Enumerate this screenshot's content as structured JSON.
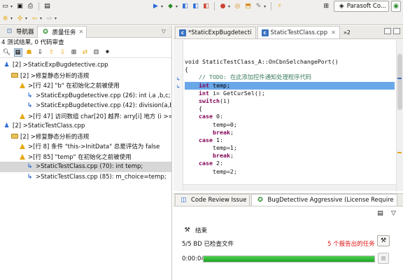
{
  "toolbar": {
    "perspective_label": "Parasoft Co...",
    "colors": {
      "run": "#2a6ad6",
      "stop": "#c43",
      "accent": "#e6a814"
    }
  },
  "left_panel": {
    "tabs": [
      {
        "label": "导航器",
        "active": false
      },
      {
        "label": "质量任务",
        "active": true
      }
    ],
    "close_glyph": "✕",
    "summary": "4 测试结果, 0 代码审查",
    "menu_glyph": "▽",
    "tree": [
      {
        "indent": 0,
        "icon": "user-violation-icon",
        "text": "[2] >StaticExpBugdetective.cpp"
      },
      {
        "indent": 1,
        "icon": "folder-icon",
        "text": "[2] >修复静态分析的违规"
      },
      {
        "indent": 2,
        "icon": "warning-icon",
        "text": ">[行 42] \"b\" 在初始化之前被使用"
      },
      {
        "indent": 3,
        "icon": "flow-step-icon",
        "text": ">StaticExpBugdetective.cpp (26): int i,a ,b,c;"
      },
      {
        "indent": 3,
        "icon": "flow-step-icon",
        "text": ">StaticExpBugdetective.cpp (42): division(a,b);"
      },
      {
        "indent": 2,
        "icon": "warning-icon",
        "text": ">[行 47] 访问数组 char[20] 越界: arry[i] 地方 (i >= 2"
      },
      {
        "indent": 0,
        "icon": "user-violation-icon",
        "text": "[2] >StaticTestClass.cpp"
      },
      {
        "indent": 1,
        "icon": "folder-icon",
        "text": "[2] >修复静态分析的违规"
      },
      {
        "indent": 2,
        "icon": "warning-icon",
        "text": ">[行 8] 条件 \"this->InitData\" 总是评估为 false"
      },
      {
        "indent": 2,
        "icon": "warning-icon",
        "text": ">[行 85] \"temp\" 在初始化之前被使用"
      },
      {
        "indent": 3,
        "icon": "flow-step-icon",
        "text": ">StaticTestClass.cpp (70): int temp;",
        "selected": true
      },
      {
        "indent": 3,
        "icon": "flow-step-icon",
        "text": ">StaticTestClass.cpp (85): m_choice=temp;"
      }
    ]
  },
  "editor": {
    "tabs": [
      {
        "label": "*StaticExpBugdetecti",
        "active": false
      },
      {
        "label": "StaticTestClass.cpp",
        "active": true
      }
    ],
    "more_tabs_label": "»2",
    "code_lines": [
      {
        "segs": [
          [
            "void StaticTestClass_A::OnCbnSelchangePort()",
            ""
          ]
        ]
      },
      {
        "segs": [
          [
            "{",
            ""
          ]
        ]
      },
      {
        "segs": [
          [
            "    ",
            ""
          ],
          [
            "// TODO: 在此添加控件通知处理程序代码",
            "cm"
          ]
        ]
      },
      {
        "segs": [
          [
            "    ",
            ""
          ],
          [
            "int",
            "kw"
          ],
          [
            " temp;",
            ""
          ]
        ],
        "hl": true
      },
      {
        "segs": [
          [
            "    ",
            ""
          ],
          [
            "int",
            "kw"
          ],
          [
            " i= GetCurSel();",
            ""
          ]
        ]
      },
      {
        "segs": [
          [
            "    ",
            ""
          ],
          [
            "switch",
            "kw"
          ],
          [
            "(i)",
            ""
          ]
        ]
      },
      {
        "segs": [
          [
            "    {",
            ""
          ]
        ]
      },
      {
        "segs": [
          [
            "    ",
            ""
          ],
          [
            "case",
            "kw"
          ],
          [
            " 0:",
            ""
          ]
        ]
      },
      {
        "segs": [
          [
            "        temp=0;",
            ""
          ]
        ]
      },
      {
        "segs": [
          [
            "        ",
            ""
          ],
          [
            "break",
            "kw"
          ],
          [
            ";",
            ""
          ]
        ]
      },
      {
        "segs": [
          [
            "    ",
            ""
          ],
          [
            "case",
            "kw"
          ],
          [
            " 1:",
            ""
          ]
        ]
      },
      {
        "segs": [
          [
            "        temp=1;",
            ""
          ]
        ]
      },
      {
        "segs": [
          [
            "        ",
            ""
          ],
          [
            "break",
            "kw"
          ],
          [
            ";",
            ""
          ]
        ]
      },
      {
        "segs": [
          [
            "    ",
            ""
          ],
          [
            "case",
            "kw"
          ],
          [
            " 2:",
            ""
          ]
        ]
      },
      {
        "segs": [
          [
            "        temp=2;",
            ""
          ]
        ]
      }
    ]
  },
  "bottom_panel": {
    "tabs": [
      {
        "label": "Code Review Issue",
        "active": false
      },
      {
        "label": "BugDetective Aggressive (License Require",
        "active": true
      }
    ],
    "status_label": "结束",
    "bd_checked": "5/5 BD 已检查文件",
    "reports": "5 个报告出的任务",
    "elapsed": "0:00:04",
    "progress": 1.0
  }
}
